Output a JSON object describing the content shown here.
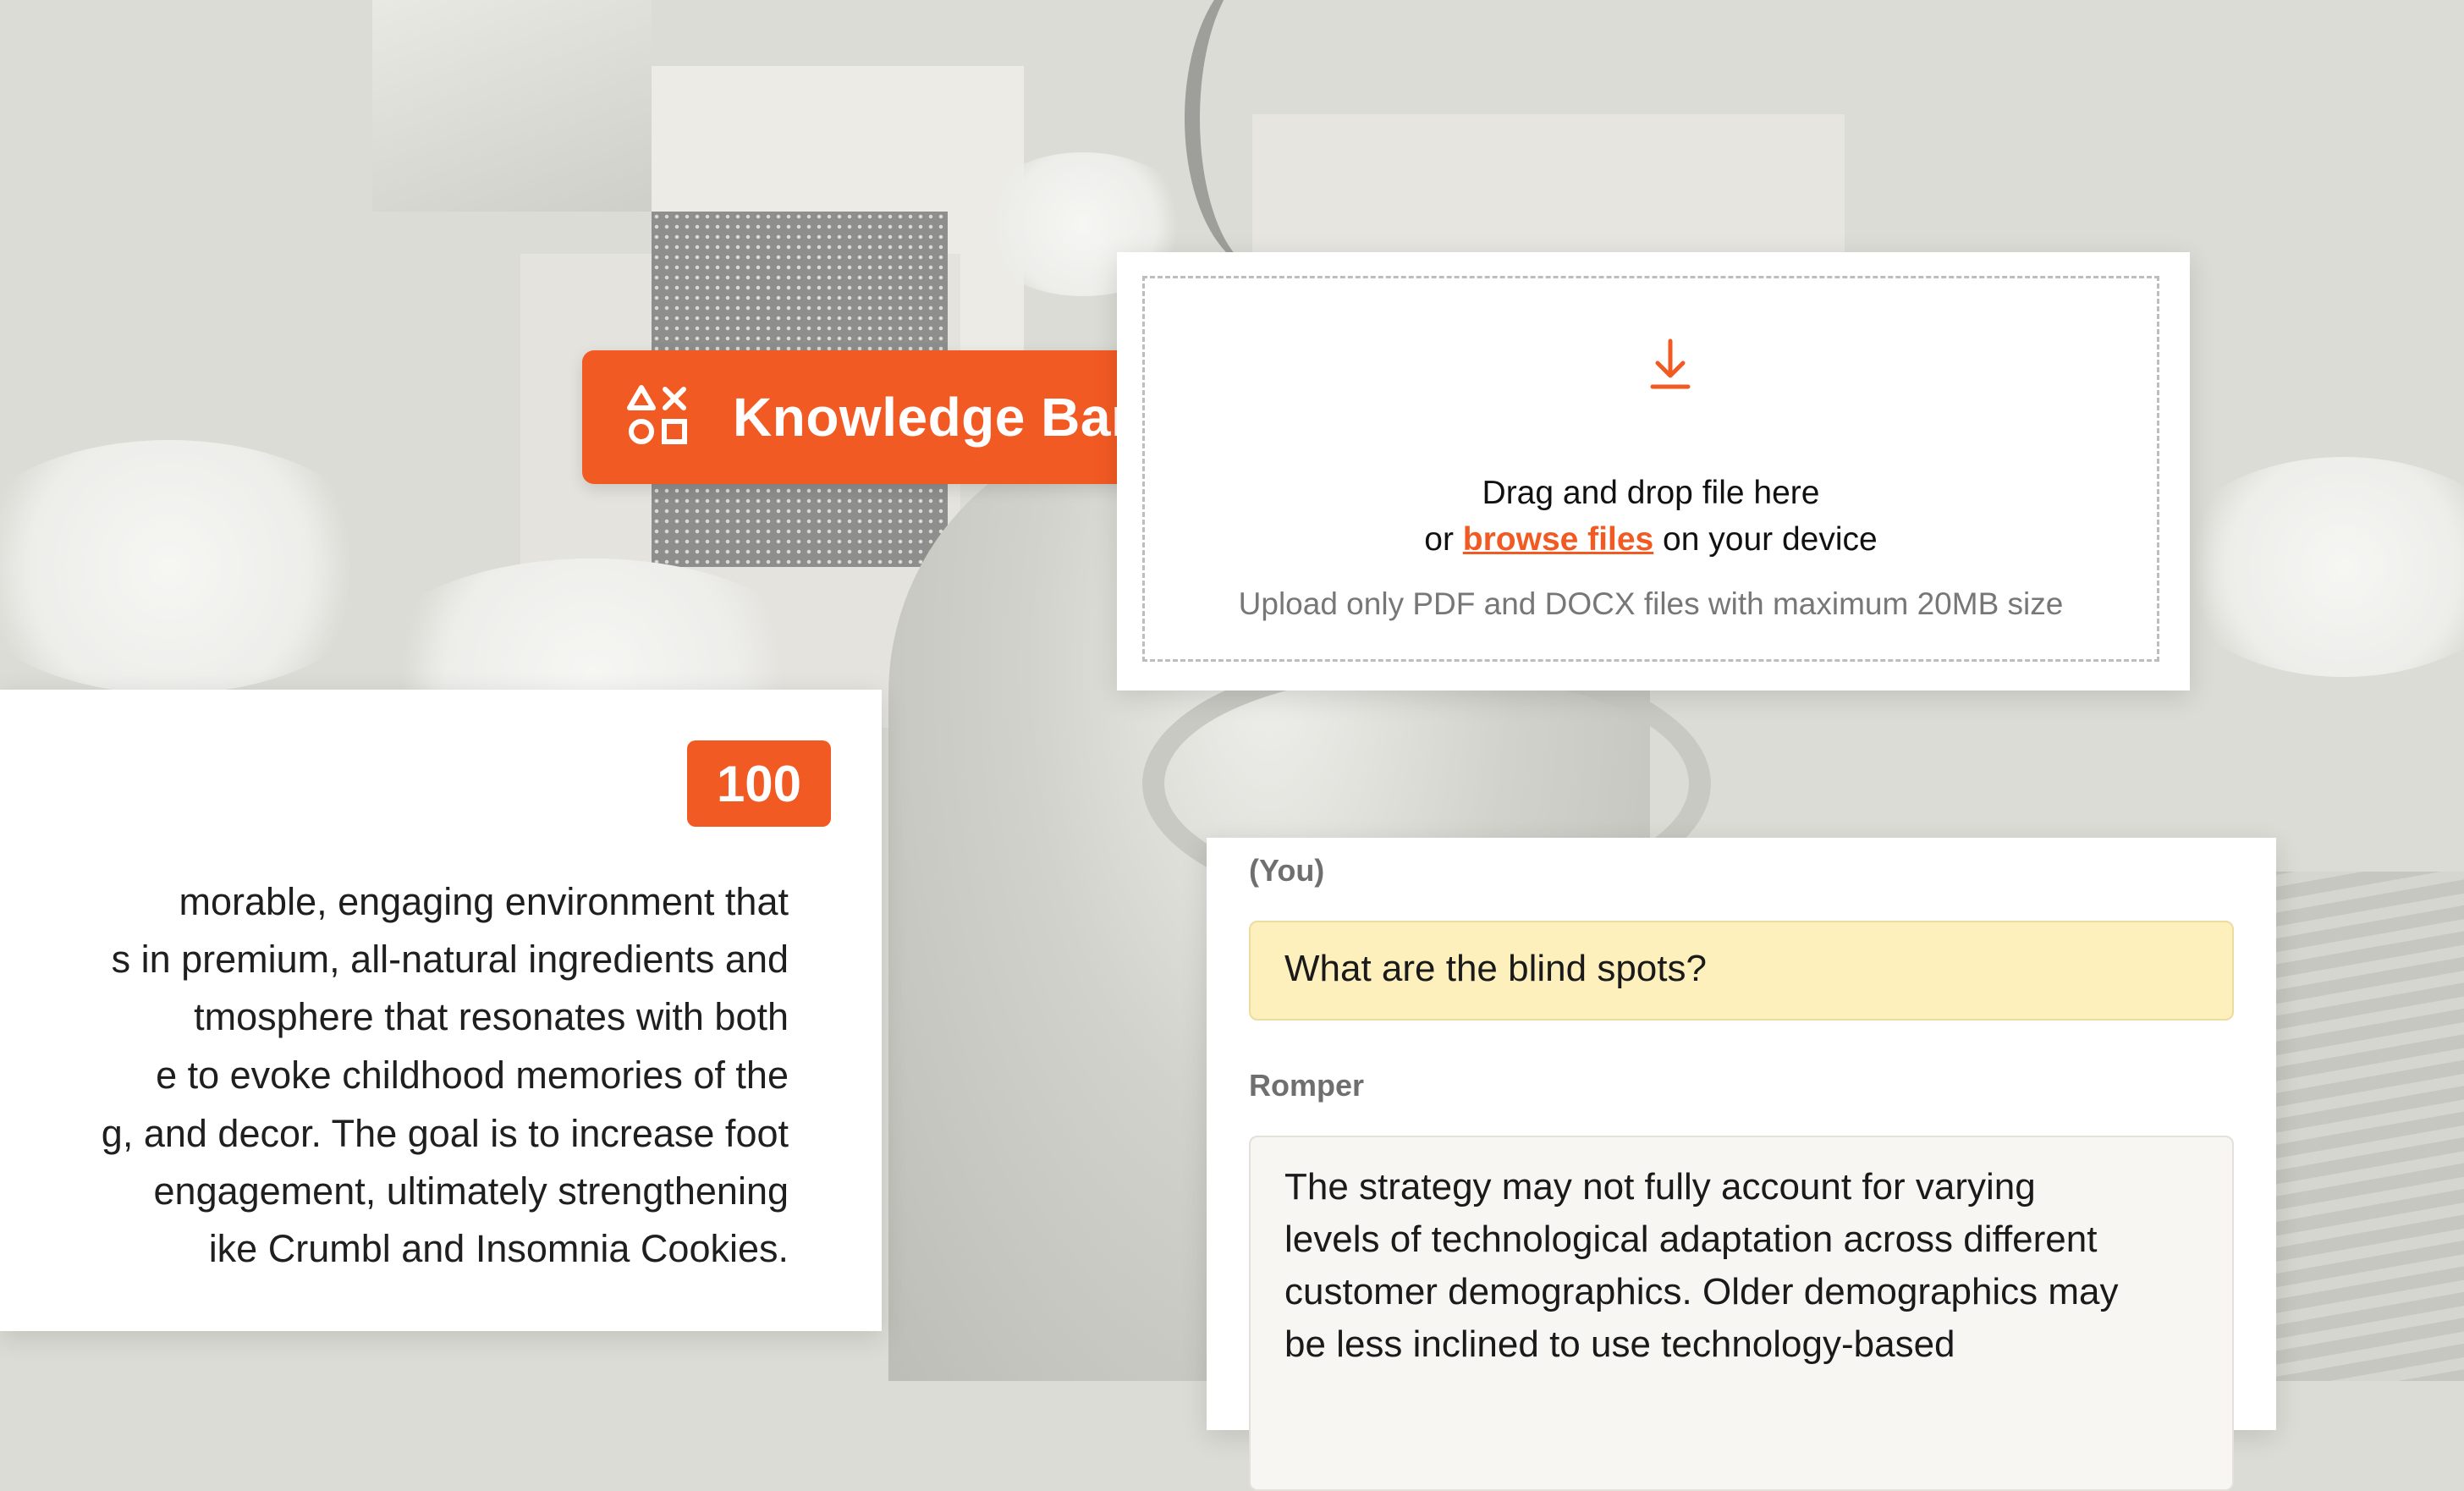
{
  "knowledge_bank": {
    "icon": "shapes-icon",
    "title": "Knowledge Bank"
  },
  "upload": {
    "icon": "download-arrow-icon",
    "line1": "Drag and drop file here",
    "line2_prefix": "or ",
    "browse_link": "browse files",
    "line2_suffix": " on your device",
    "hint": "Upload only PDF and DOCX files with maximum 20MB size"
  },
  "text_card": {
    "score": "100",
    "lines": [
      "morable, engaging environment that",
      "s in premium, all-natural ingredients and",
      "tmosphere that resonates with both",
      "e to evoke childhood memories of the",
      "g, and decor. The goal is to increase foot",
      "engagement, ultimately strengthening",
      "ike Crumbl and Insomnia Cookies."
    ]
  },
  "chat": {
    "user_label": "(You)",
    "user_message": "What are the blind spots?",
    "assistant_label": "Romper",
    "assistant_lines": [
      "The strategy may not fully account for varying",
      "levels of technological adaptation across different",
      "customer demographics. Older demographics may",
      "be less inclined to use technology-based"
    ]
  },
  "colors": {
    "accent": "#f25a23",
    "user_bubble": "#fdf0bd",
    "background": "#dcdcd6"
  }
}
